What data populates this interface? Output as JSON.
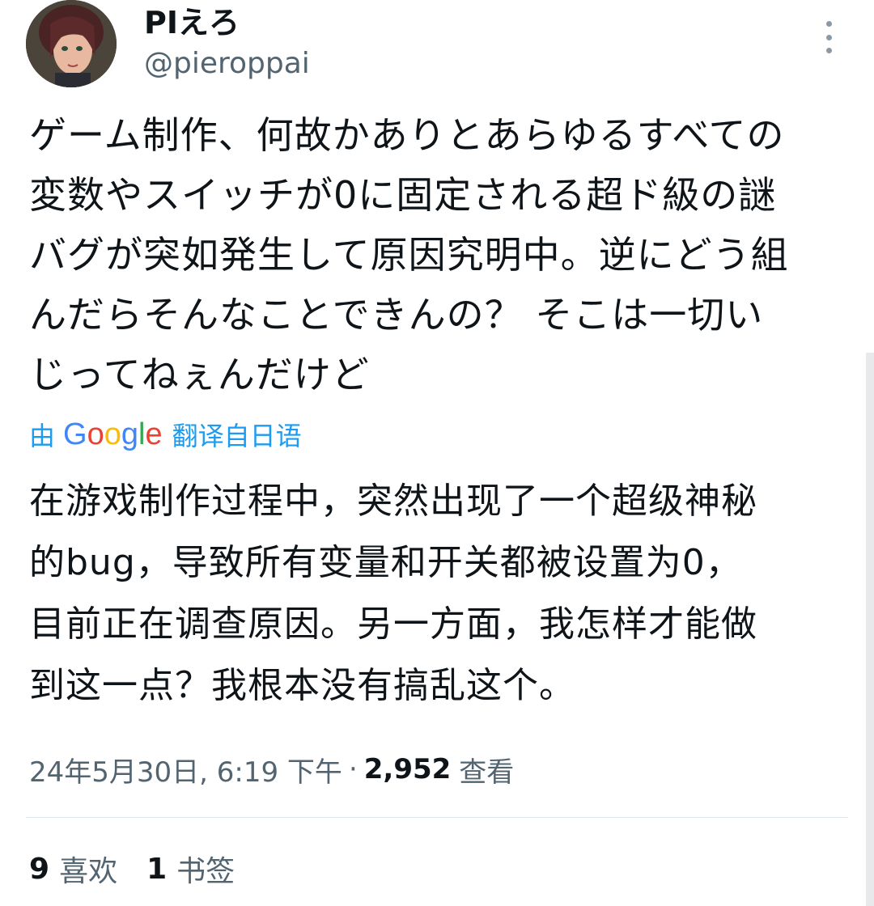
{
  "author": {
    "display_name": "PIえろ",
    "handle": "@pieroppai"
  },
  "icons": {
    "avatar": "avatar-image",
    "more": "more-vertical-icon"
  },
  "tweet": {
    "text": "ゲーム制作、何故かありとあらゆるすべての\n変数やスイッチが0に固定される超ド級の謎\nバグが突如発生して原因究明中。逆にどう組\nんだらそんなことできんの？ そこは一切い\nじってねぇんだけど"
  },
  "translation": {
    "by_label": "由",
    "google_letters": [
      "G",
      "o",
      "o",
      "g",
      "l",
      "e"
    ],
    "from_label": "翻译自日语",
    "text": "在游戏制作过程中，突然出现了一个超级神秘\n的bug，导致所有变量和开关都被设置为0，\n目前正在调查原因。另一方面，我怎样才能做\n到这一点？我根本没有搞乱这个。"
  },
  "meta": {
    "timestamp": "24年5月30日, 6:19 下午",
    "separator": "·",
    "views_count": "2,952",
    "views_label": "查看"
  },
  "stats": {
    "likes_count": "9",
    "likes_label": "喜欢",
    "bookmarks_count": "1",
    "bookmarks_label": "书签"
  },
  "colors": {
    "link_blue": "#1d9bf0",
    "secondary_text": "#536471",
    "primary_text": "#0f1419",
    "divider": "#e1e8ed"
  }
}
